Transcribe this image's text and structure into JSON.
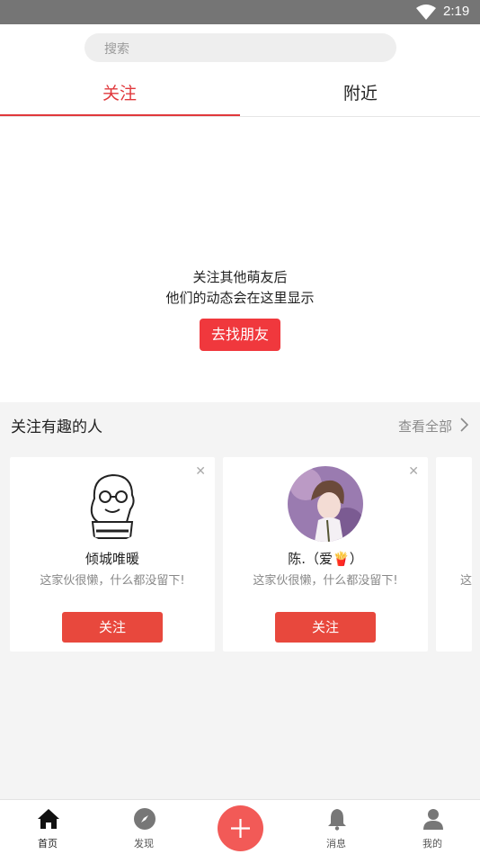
{
  "status": {
    "time": "2:19"
  },
  "search": {
    "placeholder": "搜索"
  },
  "tabs": {
    "follow": "关注",
    "nearby": "附近"
  },
  "empty_state": {
    "line1": "关注其他萌友后",
    "line2": "他们的动态会在这里显示",
    "button": "去找朋友"
  },
  "suggestions": {
    "title": "关注有趣的人",
    "view_all": "查看全部",
    "cards": [
      {
        "name": "倾城唯暖",
        "bio": "这家伙很懒，什么都没留下!",
        "button": "关注"
      },
      {
        "name": "陈.（爱🍟）",
        "bio": "这家伙很懒，什么都没留下!",
        "button": "关注"
      },
      {
        "bio_partial": "这"
      }
    ]
  },
  "nav": {
    "home": "首页",
    "discover": "发现",
    "messages": "消息",
    "me": "我的"
  },
  "colors": {
    "accent": "#e0383c",
    "follow_button": "#e8483d",
    "add_button": "#f25a57"
  }
}
